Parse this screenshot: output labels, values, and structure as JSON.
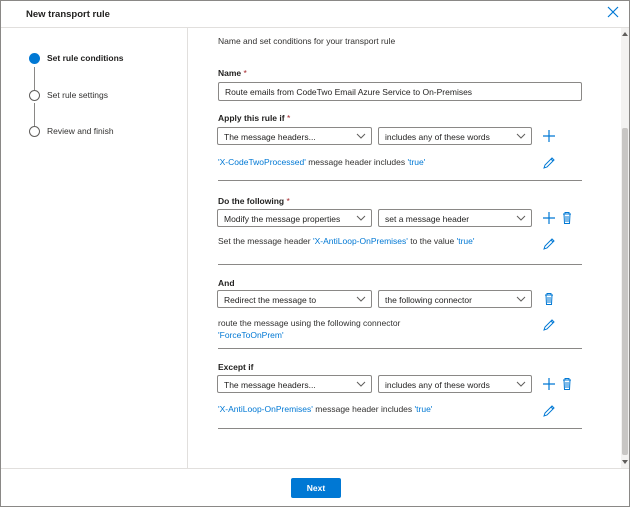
{
  "window": {
    "title": "New transport rule",
    "close_icon": "close-icon"
  },
  "steps": [
    {
      "label": "Set rule conditions",
      "active": true
    },
    {
      "label": "Set rule settings",
      "active": false
    },
    {
      "label": "Review and finish",
      "active": false
    }
  ],
  "intro": "Name and set conditions for your transport rule",
  "name_section": {
    "label": "Name",
    "required_mark": "*",
    "value": "Route emails from CodeTwo Email Azure Service to On-Premises"
  },
  "apply_if": {
    "label": "Apply this rule if",
    "required_mark": "*",
    "condition": "The message headers...",
    "operator": "includes any of these words",
    "desc_link": "'X-CodeTwoProcessed'",
    "desc_text": "message header includes",
    "desc_value": "'true'"
  },
  "do_following": {
    "label": "Do the following",
    "required_mark": "*",
    "action": "Modify the message properties",
    "sub_action": "set a message header",
    "desc_prefix": "Set the message header",
    "desc_link": "'X-AntiLoop-OnPremises'",
    "desc_mid": "to the value",
    "desc_value": "'true'"
  },
  "and_section": {
    "label": "And",
    "action": "Redirect the message to",
    "sub_action": "the following connector",
    "desc_text": "route the message using the following connector",
    "desc_link": "'ForceToOnPrem'"
  },
  "except_if": {
    "label": "Except if",
    "condition": "The message headers...",
    "operator": "includes any of these words",
    "desc_link": "'X-AntiLoop-OnPremises'",
    "desc_text": "message header includes",
    "desc_value": "'true'"
  },
  "footer": {
    "next_label": "Next"
  },
  "colors": {
    "accent": "#0078d4",
    "required": "#a4262c",
    "border": "#8a8886"
  }
}
